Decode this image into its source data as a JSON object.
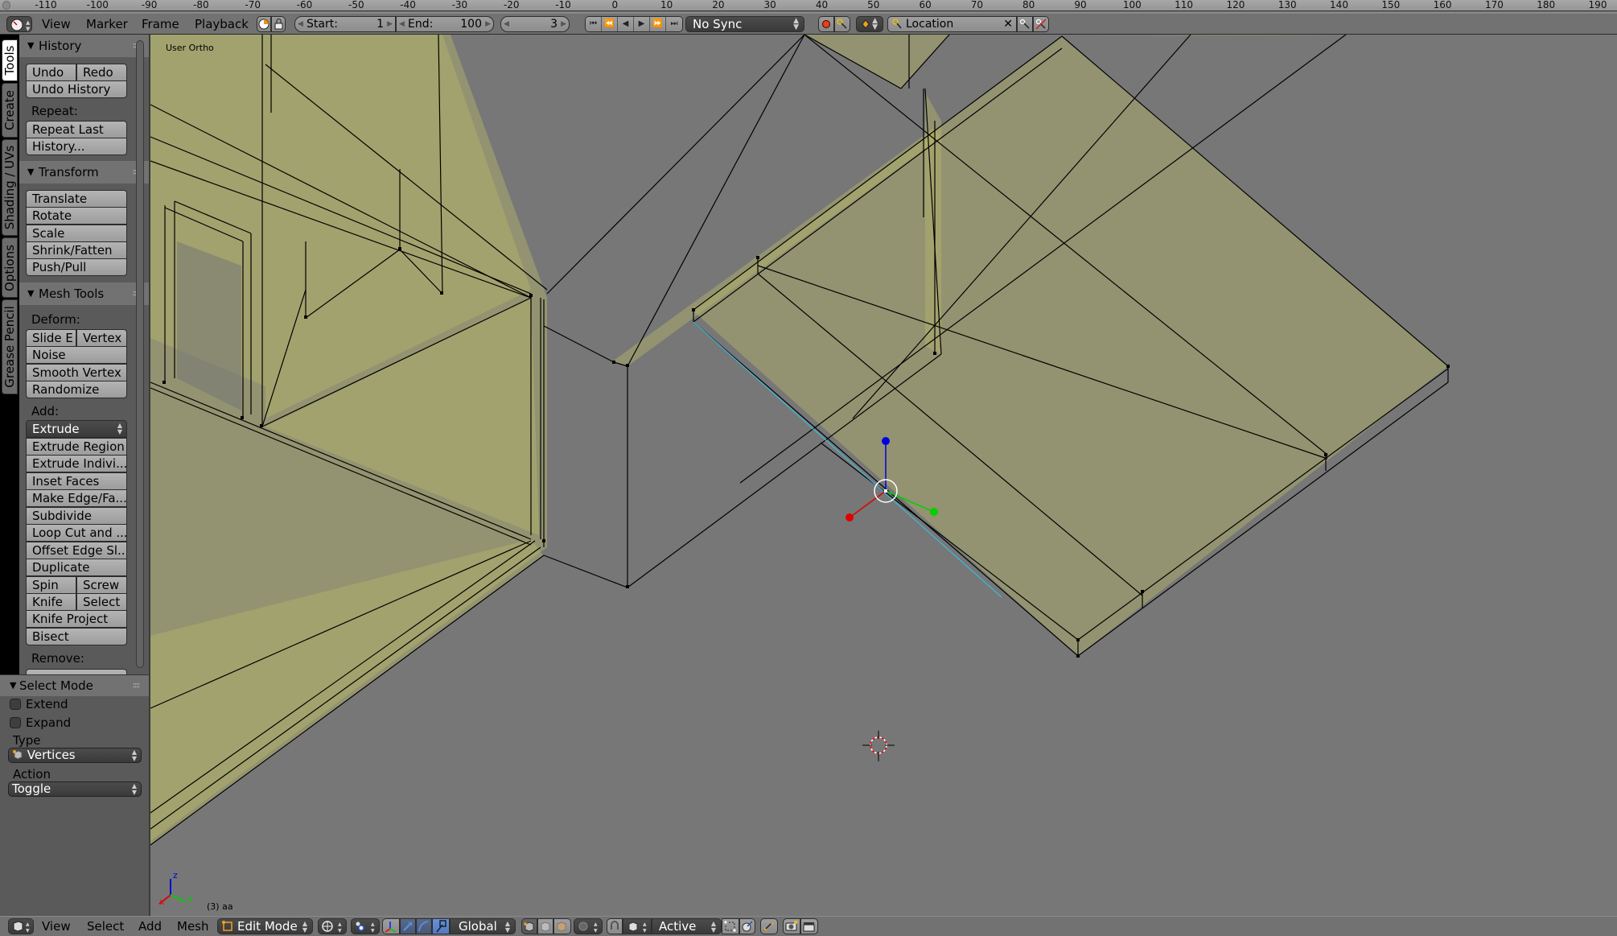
{
  "timeline": {
    "ruler_ticks": [
      "-110",
      "-100",
      "-90",
      "-80",
      "-70",
      "-60",
      "-50",
      "-40",
      "-30",
      "-20",
      "-10",
      "0",
      "10",
      "20",
      "30",
      "40",
      "50",
      "60",
      "70",
      "80",
      "90",
      "100",
      "110",
      "120",
      "130",
      "140",
      "150",
      "160",
      "170",
      "180",
      "190"
    ],
    "menu": [
      "View",
      "Marker",
      "Frame",
      "Playback"
    ],
    "start_label": "Start:",
    "start_value": "1",
    "end_label": "End:",
    "end_value": "100",
    "current_frame": "3",
    "sync": "No Sync",
    "keying_set": "Location",
    "icons": {
      "editor_type": "clock-icon",
      "preview_range": "preview-range-icon",
      "lock": "lock-icon",
      "playback": [
        "jump-start-icon",
        "prev-keyframe-icon",
        "play-reverse-icon",
        "play-icon",
        "next-keyframe-icon",
        "jump-end-icon"
      ],
      "record": "record-icon",
      "keyframe": "keyframe-icon"
    }
  },
  "tool_tabs": [
    "Tools",
    "Create",
    "Shading / UVs",
    "Options",
    "Grease Pencil"
  ],
  "active_tab": "Tools",
  "panels": {
    "history": {
      "title": "History",
      "undo": "Undo",
      "redo": "Redo",
      "undo_history": "Undo History",
      "repeat_label": "Repeat:",
      "repeat_last": "Repeat Last",
      "history": "History..."
    },
    "transform": {
      "title": "Transform",
      "buttons": [
        "Translate",
        "Rotate",
        "Scale",
        "Shrink/Fatten",
        "Push/Pull"
      ]
    },
    "mesh_tools": {
      "title": "Mesh Tools",
      "deform_label": "Deform:",
      "slide_edge": "Slide E",
      "vertex": "Vertex",
      "noise": "Noise",
      "smooth_vertex": "Smooth Vertex",
      "randomize": "Randomize",
      "add_label": "Add:",
      "extrude": "Extrude",
      "add_buttons": [
        "Extrude Region",
        "Extrude Indivi...",
        "Inset Faces",
        "Make Edge/Fa...",
        "Subdivide",
        "Loop Cut and ...",
        "Offset Edge Sl...",
        "Duplicate"
      ],
      "spin": "Spin",
      "screw": "Screw",
      "knife": "Knife",
      "select": "Select",
      "knife_project": "Knife Project",
      "bisect": "Bisect",
      "remove_label": "Remove:"
    }
  },
  "operator_panel": {
    "title": "Select Mode",
    "extend_label": "Extend",
    "extend_checked": false,
    "expand_label": "Expand",
    "expand_checked": false,
    "type_label": "Type",
    "type_value": "Vertices",
    "action_label": "Action",
    "action_value": "Toggle"
  },
  "viewport": {
    "view_name": "User Ortho",
    "object_info": "(3) aa",
    "axis_labels": {
      "x": "x",
      "y": "y",
      "z": "z"
    },
    "colors": {
      "background": "#777777",
      "mesh_face": "#b5b56a",
      "edge": "#000000",
      "selected_edge": "#3ab8d8",
      "axis_x": "#e00000",
      "axis_y": "#00d000",
      "axis_z": "#0000e0"
    }
  },
  "view3d_header": {
    "menu": [
      "View",
      "Select",
      "Add",
      "Mesh"
    ],
    "mode": "Edit Mode",
    "orientation": "Global",
    "pivot_icon": "pivot-median-icon",
    "proportional": "Active",
    "icons": [
      "view3d-editor-icon",
      "viewport-shading-icon",
      "pivot-icon",
      "manipulator-icon",
      "translate-icon",
      "rotate-icon",
      "scale-icon",
      "vertex-select-icon",
      "edge-select-icon",
      "face-select-icon",
      "proportional-icon",
      "snap-icon",
      "snap-element-icon",
      "snap-target-icon",
      "retopology-icon",
      "mirror-icon",
      "opengl-render-icon",
      "opengl-anim-icon"
    ]
  }
}
